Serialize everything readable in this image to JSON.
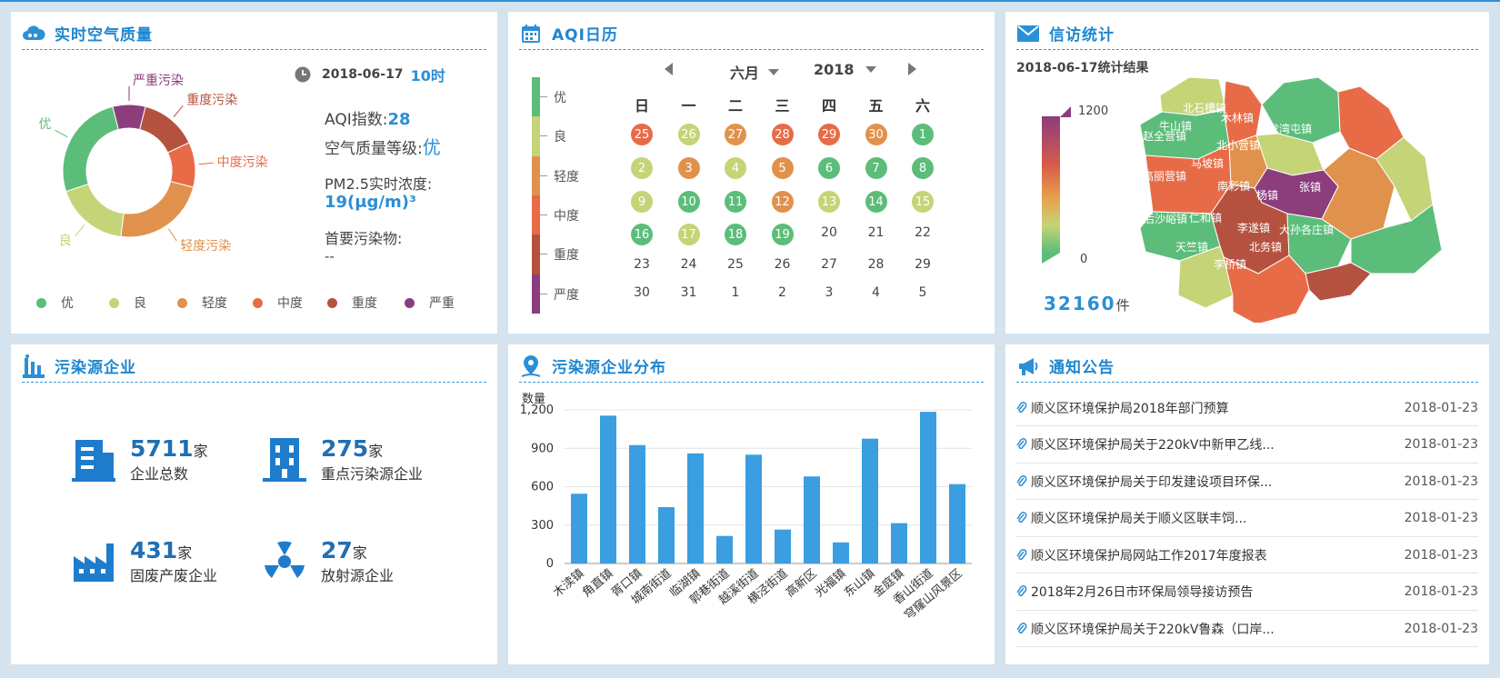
{
  "air": {
    "title": "实时空气质量",
    "date": "2018-06-17",
    "hour": "10时",
    "aqi_label": "AQI指数:",
    "aqi_value": "28",
    "grade_label": "空气质量等级:",
    "grade_value": "优",
    "pm_label": "PM2.5实时浓度:",
    "pm_value": "19(μg/m)³",
    "primary_label": "首要污染物:",
    "primary_value": "--",
    "donut_labels": [
      "优",
      "良",
      "轻度污染",
      "中度污染",
      "重度污染",
      "严重污染"
    ],
    "donut_values": [
      26,
      18,
      23,
      11,
      14,
      8
    ],
    "legend": [
      "优",
      "良",
      "轻度",
      "中度",
      "重度",
      "严重"
    ]
  },
  "colors": [
    "#5cbd7a",
    "#c4d477",
    "#e0924c",
    "#e86b48",
    "#b5523f",
    "#8b3d7c"
  ],
  "calendar": {
    "title": "AQI日历",
    "month": "六月",
    "year": "2018",
    "weekdays": [
      "日",
      "一",
      "二",
      "三",
      "四",
      "五",
      "六"
    ],
    "scale": [
      "优",
      "良",
      "轻度",
      "中度",
      "重度",
      "严度"
    ],
    "rows": [
      [
        "25",
        "26",
        "27",
        "28",
        "29",
        "30",
        "1"
      ],
      [
        "2",
        "3",
        "4",
        "5",
        "6",
        "7",
        "8"
      ],
      [
        "9",
        "10",
        "11",
        "12",
        "13",
        "14",
        "15"
      ],
      [
        "16",
        "17",
        "18",
        "19",
        "20",
        "21",
        "22"
      ],
      [
        "23",
        "24",
        "25",
        "26",
        "27",
        "28",
        "29"
      ],
      [
        "30",
        "31",
        "1",
        "2",
        "3",
        "4",
        "5"
      ]
    ],
    "levels": [
      [
        3,
        1,
        2,
        3,
        3,
        2,
        0
      ],
      [
        1,
        2,
        1,
        2,
        0,
        0,
        0
      ],
      [
        1,
        0,
        0,
        2,
        1,
        0,
        1
      ],
      [
        0,
        1,
        0,
        0,
        -1,
        -1,
        -1
      ],
      [
        -1,
        -1,
        -1,
        -1,
        -1,
        -1,
        -1
      ],
      [
        -1,
        -1,
        -1,
        -1,
        -1,
        -1,
        -1
      ]
    ]
  },
  "petition": {
    "title": "信访统计",
    "result": "2018-06-17统计结果",
    "scale_max": "1200",
    "scale_min": "0",
    "total": "32160",
    "total_unit": "件",
    "towns": [
      "北石槽镇",
      "牛山镇",
      "赵全营镇",
      "木林镇",
      "龙湾屯镇",
      "北小营镇",
      "马坡镇",
      "高丽营镇",
      "南彩镇",
      "杨镇",
      "张镇",
      "后沙峪镇",
      "仁和镇",
      "李遂镇",
      "大孙各庄镇",
      "天竺镇",
      "北务镇",
      "李桥镇"
    ]
  },
  "enterprise": {
    "title": "污染源企业",
    "stats": [
      {
        "num": "5711",
        "unit": "家",
        "label": "企业总数"
      },
      {
        "num": "275",
        "unit": "家",
        "label": "重点污染源企业"
      },
      {
        "num": "431",
        "unit": "家",
        "label": "固废产废企业"
      },
      {
        "num": "27",
        "unit": "家",
        "label": "放射源企业"
      }
    ]
  },
  "distribution": {
    "title": "污染源企业分布",
    "ylabel_text": "数量"
  },
  "chart_data": {
    "type": "bar",
    "title": "",
    "ylabel": "数量",
    "categories": [
      "木渎镇",
      "角直镇",
      "胥口镇",
      "城南街道",
      "临湖镇",
      "郭巷街道",
      "越溪街道",
      "横泾街道",
      "高新区",
      "光福镇",
      "东山镇",
      "金庭镇",
      "香山街道",
      "穹窿山风景区"
    ],
    "values": [
      545,
      1155,
      925,
      440,
      860,
      215,
      850,
      265,
      680,
      165,
      975,
      315,
      1185,
      620
    ],
    "ylim": [
      0,
      1200
    ],
    "yticks": [
      "0",
      "300",
      "600",
      "900",
      "1,200"
    ],
    "grid": true
  },
  "notices": {
    "title": "通知公告",
    "items": [
      {
        "text": "顺义区环境保护局2018年部门预算",
        "date": "2018-01-23"
      },
      {
        "text": "顺义区环境保护局关于220kV中新甲乙线...",
        "date": "2018-01-23"
      },
      {
        "text": "顺义区环境保护局关于印发建设项目环保...",
        "date": "2018-01-23"
      },
      {
        "text": "顺义区环境保护局关于顺义区联丰饲...",
        "date": "2018-01-23"
      },
      {
        "text": "顺义区环境保护局网站工作2017年度报表",
        "date": "2018-01-23"
      },
      {
        "text": "2018年2月26日市环保局领导接访预告",
        "date": "2018-01-23"
      },
      {
        "text": "顺义区环境保护局关于220kV鲁森（口岸...",
        "date": "2018-01-23"
      }
    ]
  }
}
